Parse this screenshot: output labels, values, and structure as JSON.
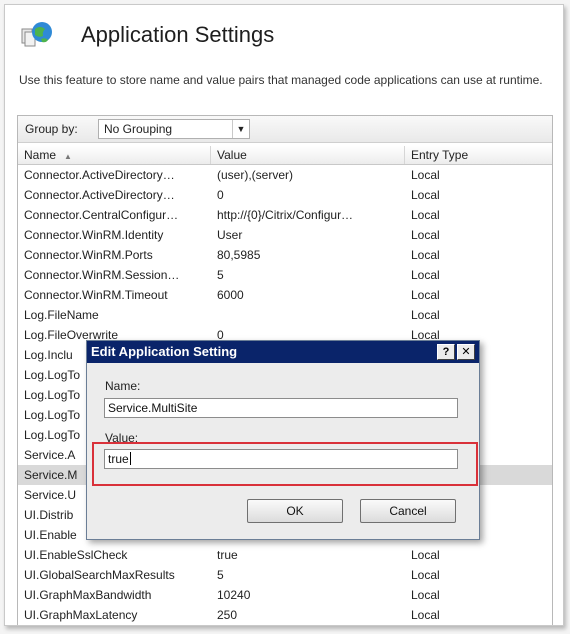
{
  "page": {
    "title": "Application Settings",
    "description": "Use this feature to store name and value pairs that managed code applications can use at runtime."
  },
  "toolbar": {
    "group_by_label": "Group by:",
    "group_by_value": "No Grouping"
  },
  "table": {
    "columns": [
      "Name",
      "Value",
      "Entry Type"
    ],
    "sort_column": "Name",
    "sort_direction": "ascending",
    "rows": [
      {
        "name": "Connector.ActiveDirectory…",
        "value": "(user),(server)",
        "type": "Local"
      },
      {
        "name": "Connector.ActiveDirectory…",
        "value": "0",
        "type": "Local"
      },
      {
        "name": "Connector.CentralConfigur…",
        "value": "http://{0}/Citrix/Configur…",
        "type": "Local"
      },
      {
        "name": "Connector.WinRM.Identity",
        "value": "User",
        "type": "Local"
      },
      {
        "name": "Connector.WinRM.Ports",
        "value": "80,5985",
        "type": "Local"
      },
      {
        "name": "Connector.WinRM.Session…",
        "value": "5",
        "type": "Local"
      },
      {
        "name": "Connector.WinRM.Timeout",
        "value": "6000",
        "type": "Local"
      },
      {
        "name": "Log.FileName",
        "value": "",
        "type": "Local"
      },
      {
        "name": "Log.FileOverwrite",
        "value": "0",
        "type": "Local"
      },
      {
        "name": "Log.Inclu",
        "value": "",
        "type": ""
      },
      {
        "name": "Log.LogTo",
        "value": "",
        "type": ""
      },
      {
        "name": "Log.LogTo",
        "value": "",
        "type": ""
      },
      {
        "name": "Log.LogTo",
        "value": "",
        "type": ""
      },
      {
        "name": "Log.LogTo",
        "value": "",
        "type": ""
      },
      {
        "name": "Service.A",
        "value": "",
        "type": ""
      },
      {
        "name": "Service.M",
        "value": "",
        "type": "",
        "selected": true
      },
      {
        "name": "Service.U",
        "value": "",
        "type": ""
      },
      {
        "name": "UI.Distrib",
        "value": "",
        "type": ""
      },
      {
        "name": "UI.Enable",
        "value": "",
        "type": ""
      },
      {
        "name": "UI.EnableSslCheck",
        "value": "true",
        "type": "Local"
      },
      {
        "name": "UI.GlobalSearchMaxResults",
        "value": "5",
        "type": "Local"
      },
      {
        "name": "UI.GraphMaxBandwidth",
        "value": "10240",
        "type": "Local"
      },
      {
        "name": "UI.GraphMaxLatency",
        "value": "250",
        "type": "Local"
      }
    ]
  },
  "dialog": {
    "title": "Edit Application Setting",
    "help_label": "?",
    "close_label": "✕",
    "name_label": "Name:",
    "name_value": "Service.MultiSite",
    "value_label": "Value:",
    "value_value": "true",
    "ok_label": "OK",
    "cancel_label": "Cancel",
    "highlight_color": "#d9313a"
  },
  "colors": {
    "titlebar": "#0a246a",
    "selected_row": "#d9d9d9"
  }
}
